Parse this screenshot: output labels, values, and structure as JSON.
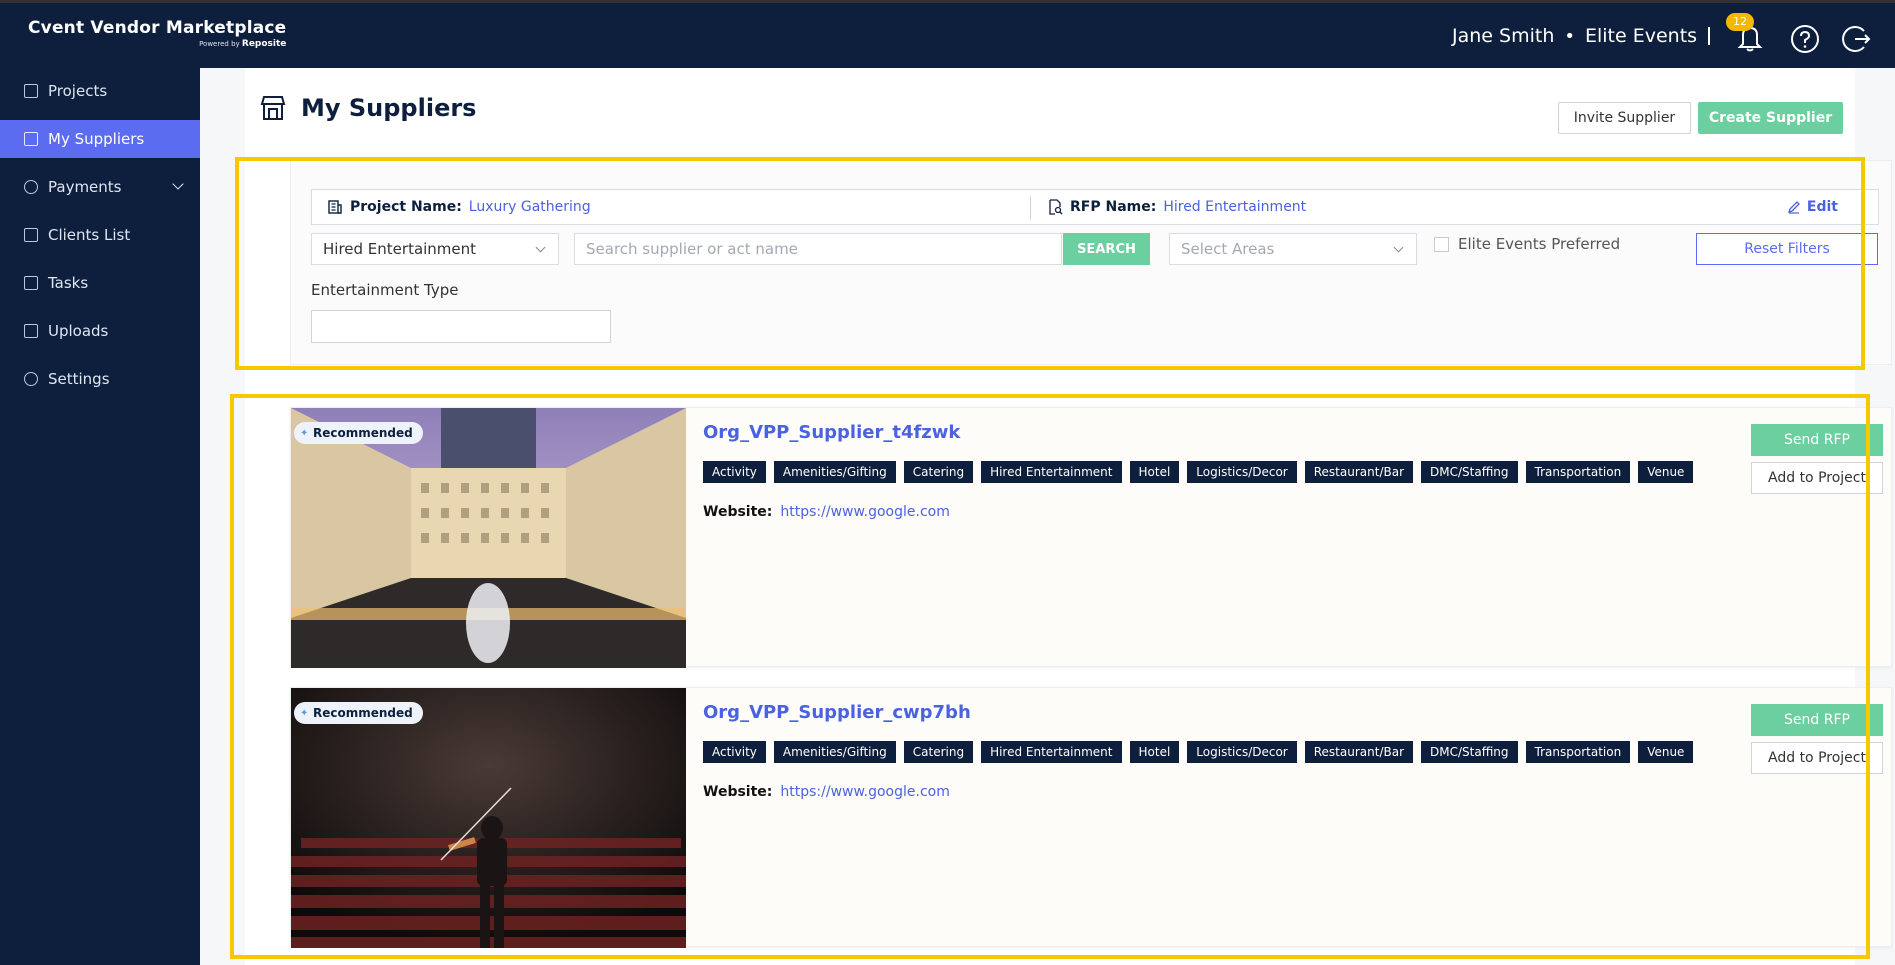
{
  "app": {
    "title": "Cvent Vendor Marketplace",
    "powered_by_prefix": "Powered by",
    "powered_by_brand": "Reposite"
  },
  "header": {
    "user_name": "Jane Smith",
    "separator": "•",
    "company": "Elite Events",
    "notification_count": "12"
  },
  "sidebar": {
    "items": [
      {
        "label": "Projects",
        "icon": "projects-icon",
        "active": false
      },
      {
        "label": "My Suppliers",
        "icon": "suppliers-icon",
        "active": true
      },
      {
        "label": "Payments",
        "icon": "payments-icon",
        "active": false,
        "has_submenu": true
      },
      {
        "label": "Clients List",
        "icon": "clients-icon",
        "active": false
      },
      {
        "label": "Tasks",
        "icon": "tasks-icon",
        "active": false
      },
      {
        "label": "Uploads",
        "icon": "upload-icon",
        "active": false
      },
      {
        "label": "Settings",
        "icon": "settings-icon",
        "active": false
      }
    ]
  },
  "page": {
    "title": "My Suppliers",
    "invite_label": "Invite Supplier",
    "create_label": "Create Supplier"
  },
  "filters": {
    "project_label": "Project Name:",
    "project_value": "Luxury Gathering",
    "rfp_label": "RFP Name:",
    "rfp_value": "Hired Entertainment",
    "edit_label": "Edit",
    "type_select_value": "Hired Entertainment",
    "search_placeholder": "Search supplier or act name",
    "search_button": "SEARCH",
    "areas_placeholder": "Select Areas",
    "preferred_label": "Elite Events Preferred",
    "reset_label": "Reset Filters",
    "entertainment_type_label": "Entertainment Type",
    "entertainment_type_value": ""
  },
  "suppliers": [
    {
      "badge": "Recommended",
      "name": "Org_VPP_Supplier_t4fzwk",
      "tags": [
        "Activity",
        "Amenities/Gifting",
        "Catering",
        "Hired Entertainment",
        "Hotel",
        "Logistics/Decor",
        "Restaurant/Bar",
        "DMC/Staffing",
        "Transportation",
        "Venue"
      ],
      "website_label": "Website:",
      "website_url": "https://www.google.com",
      "send_rfp_label": "Send RFP",
      "add_project_label": "Add to Project"
    },
    {
      "badge": "Recommended",
      "name": "Org_VPP_Supplier_cwp7bh",
      "tags": [
        "Activity",
        "Amenities/Gifting",
        "Catering",
        "Hired Entertainment",
        "Hotel",
        "Logistics/Decor",
        "Restaurant/Bar",
        "DMC/Staffing",
        "Transportation",
        "Venue"
      ],
      "website_label": "Website:",
      "website_url": "https://www.google.com",
      "send_rfp_label": "Send RFP",
      "add_project_label": "Add to Project"
    }
  ],
  "colors": {
    "navy": "#0d1f3c",
    "accent_blue": "#5b6cf0",
    "accent_green": "#6ccfa0",
    "highlight_yellow": "#f5c800",
    "badge_yellow": "#f5b800"
  }
}
